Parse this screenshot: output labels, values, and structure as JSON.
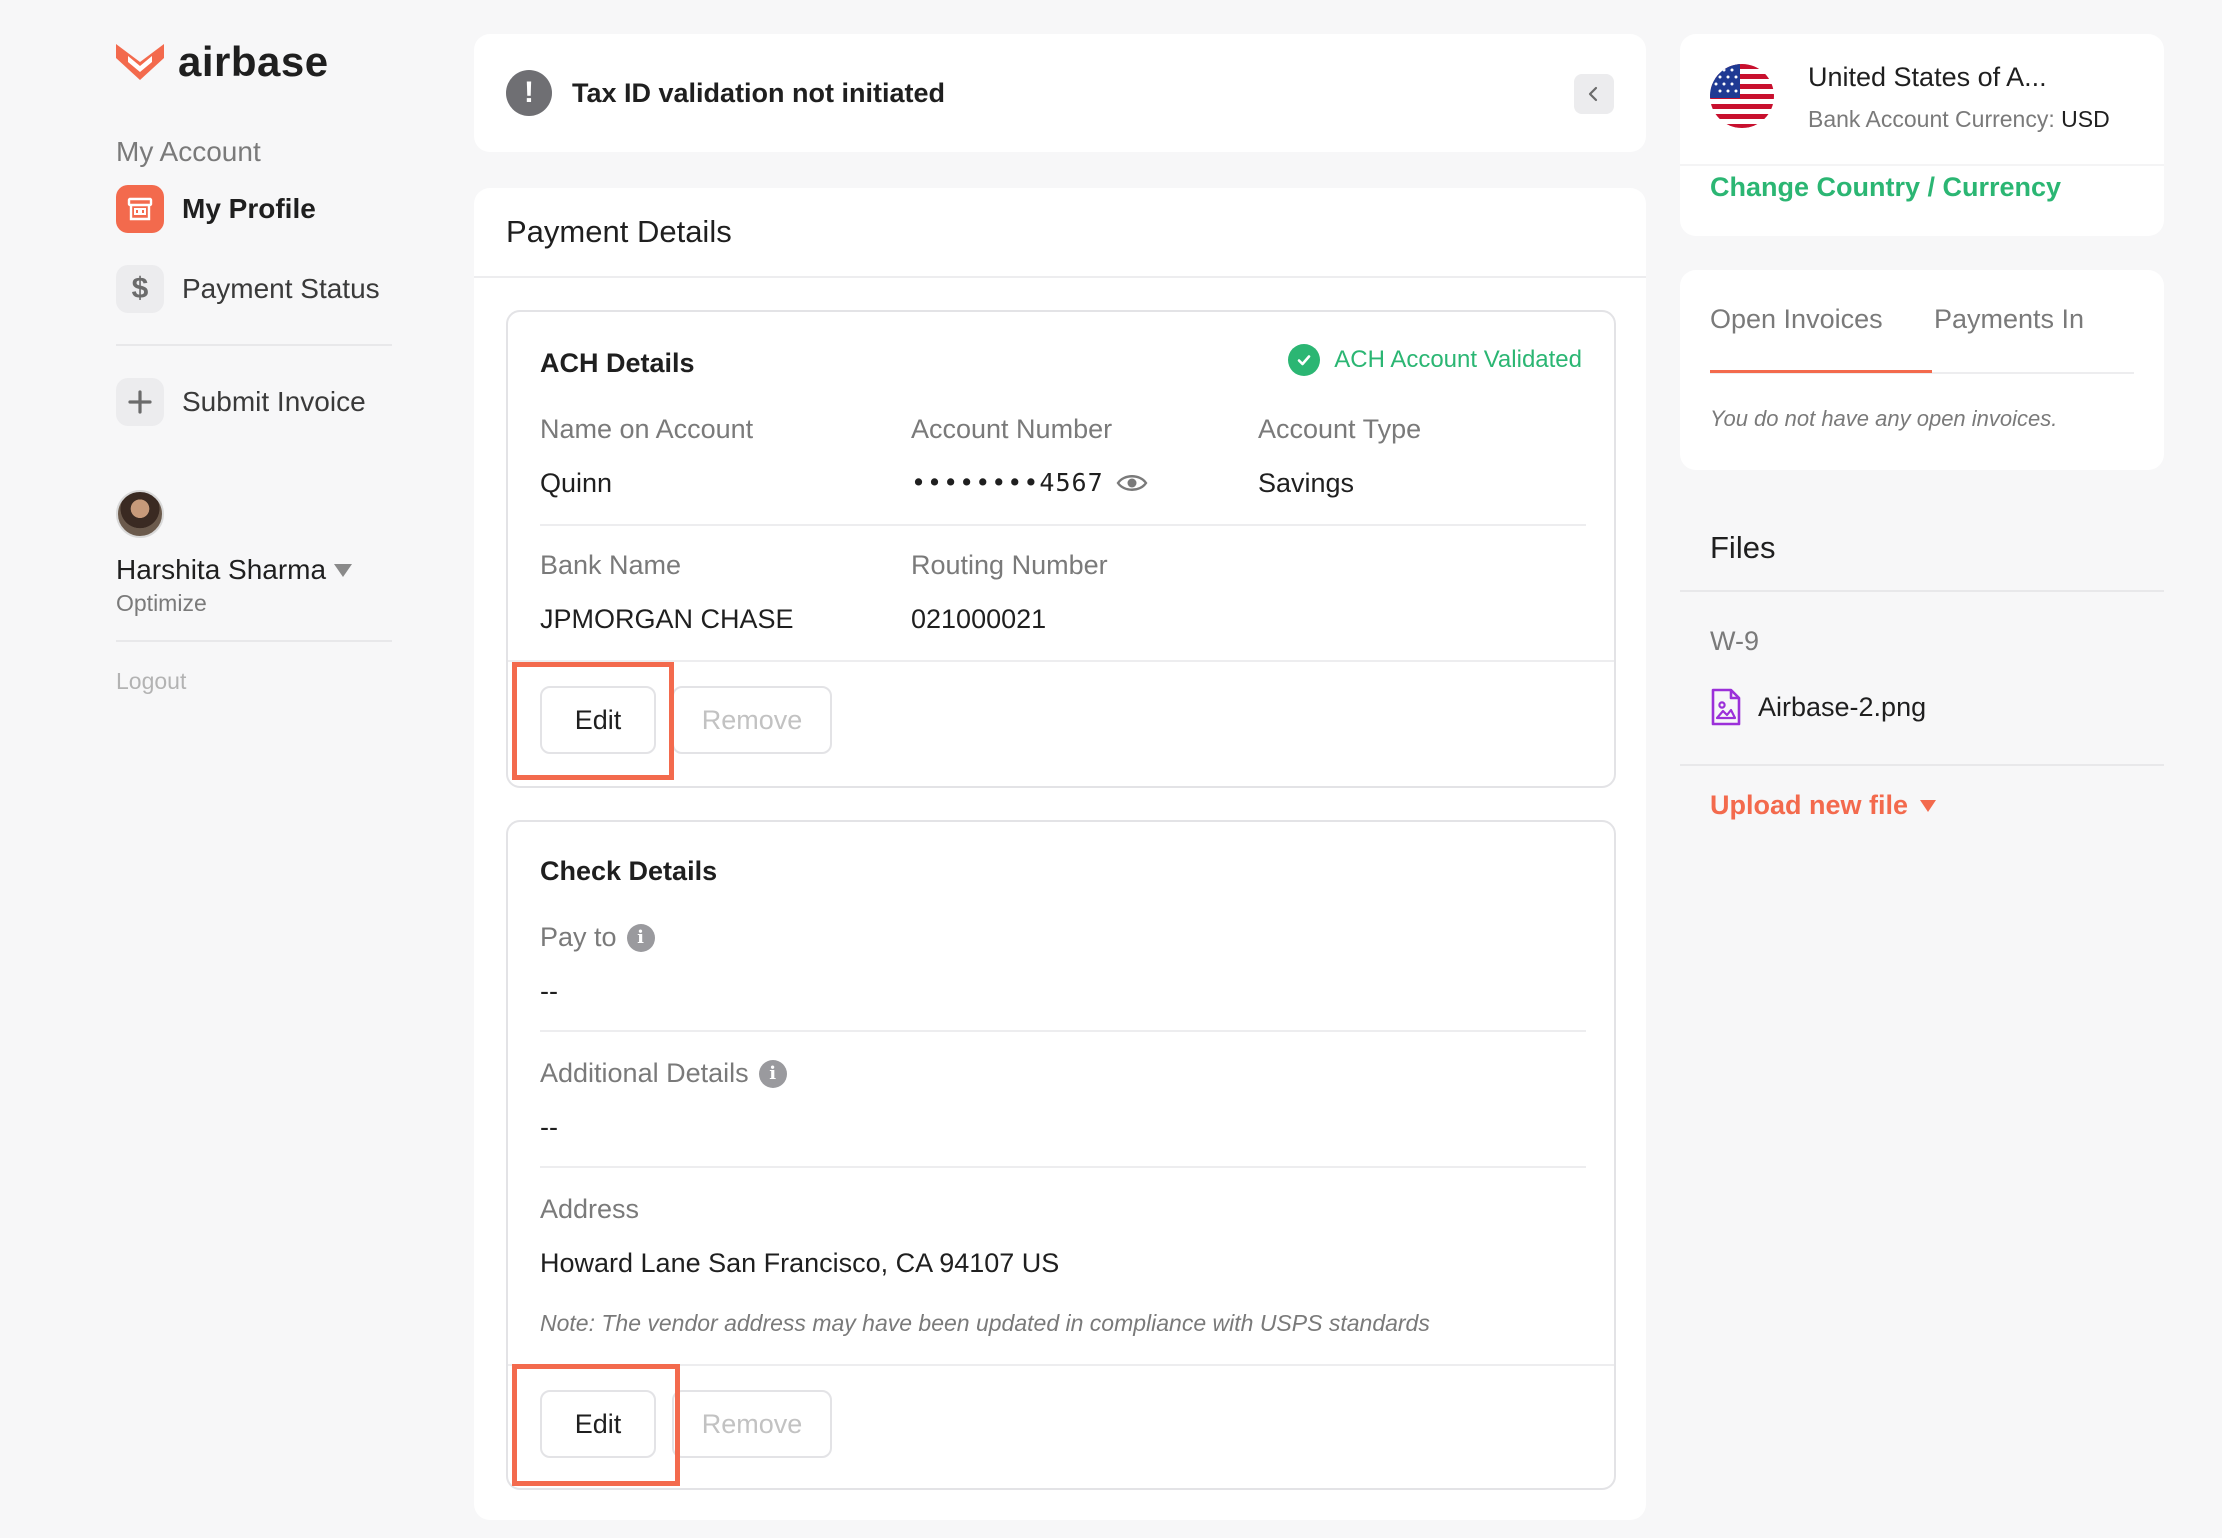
{
  "brand": {
    "name": "airbase",
    "accent": "#f36a4d",
    "success": "#2bb673"
  },
  "sidebar": {
    "section_label": "My Account",
    "items": [
      {
        "label": "My Profile",
        "icon": "storefront-icon",
        "active": true
      },
      {
        "label": "Payment Status",
        "icon": "dollar-icon",
        "active": false
      },
      {
        "label": "Submit Invoice",
        "icon": "plus-icon",
        "active": false
      }
    ],
    "user": {
      "name": "Harshita Sharma",
      "org": "Optimize"
    },
    "logout_label": "Logout"
  },
  "banner": {
    "text": "Tax ID validation not initiated",
    "icon": "exclamation-icon"
  },
  "payment": {
    "title": "Payment Details",
    "ach": {
      "title": "ACH Details",
      "status": "ACH Account Validated",
      "name_label": "Name on Account",
      "name_value": "Quinn",
      "account_number_label": "Account Number",
      "account_number_mask": "••••••••",
      "account_number_last4": "4567",
      "account_type_label": "Account Type",
      "account_type_value": "Savings",
      "bank_label": "Bank Name",
      "bank_value": "JPMORGAN CHASE",
      "routing_label": "Routing Number",
      "routing_value": "021000021",
      "edit_label": "Edit",
      "remove_label": "Remove"
    },
    "check": {
      "title": "Check Details",
      "pay_to_label": "Pay to",
      "pay_to_value": "--",
      "additional_label": "Additional Details",
      "additional_value": "--",
      "address_label": "Address",
      "address_value": "Howard Lane San Francisco, CA 94107 US",
      "note": "Note: The vendor address may have been updated in compliance with USPS standards",
      "edit_label": "Edit",
      "remove_label": "Remove"
    }
  },
  "currency": {
    "country": "United States of A...",
    "currency_label": "Bank Account Currency:",
    "currency_value": "USD",
    "change_link": "Change Country / Currency"
  },
  "invoices": {
    "tabs": [
      {
        "label": "Open Invoices",
        "active": true
      },
      {
        "label": "Payments In",
        "active": false
      }
    ],
    "empty_message": "You do not have any open invoices."
  },
  "files": {
    "title": "Files",
    "category": "W-9",
    "file_name": "Airbase-2.png",
    "upload_label": "Upload new file"
  }
}
